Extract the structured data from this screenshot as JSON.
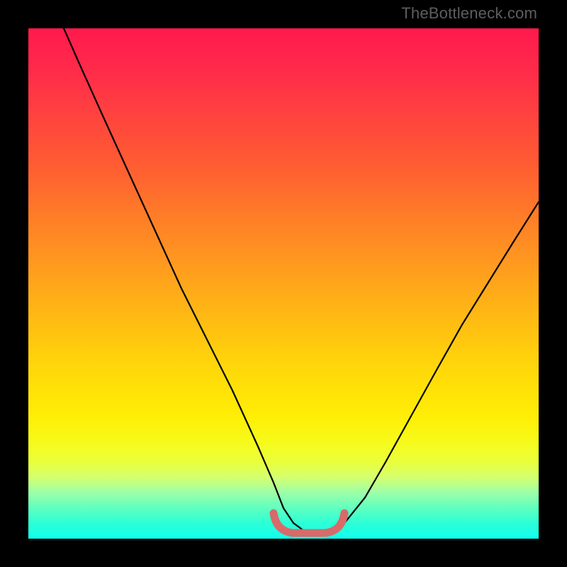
{
  "branding": {
    "watermark": "TheBottleneck.com"
  },
  "chart_data": {
    "type": "line",
    "title": "",
    "xlabel": "",
    "ylabel": "",
    "xlim": [
      0,
      100
    ],
    "ylim": [
      0,
      100
    ],
    "grid": false,
    "legend": false,
    "series": [
      {
        "name": "bottleneck-curve",
        "x": [
          7,
          10,
          15,
          20,
          25,
          30,
          35,
          40,
          45,
          48,
          50,
          52,
          54,
          56,
          58,
          60,
          62,
          66,
          70,
          75,
          80,
          85,
          90,
          95,
          100
        ],
        "values": [
          100,
          93,
          82,
          71,
          60,
          49,
          39,
          29,
          18,
          11,
          6,
          3,
          1.5,
          1.2,
          1.2,
          1.5,
          3,
          8,
          15,
          24,
          33,
          42,
          50,
          58,
          66
        ]
      }
    ],
    "bottom_marker": {
      "name": "optimal-range",
      "x_start": 48,
      "x_end": 62,
      "y": 1.5,
      "color": "#d86a6a"
    },
    "gradient_stops": [
      {
        "pos": 0,
        "color": "#ff1a4d"
      },
      {
        "pos": 25,
        "color": "#ff6a2e"
      },
      {
        "pos": 50,
        "color": "#ffb814"
      },
      {
        "pos": 75,
        "color": "#ffee05"
      },
      {
        "pos": 100,
        "color": "#11fff1"
      }
    ]
  }
}
